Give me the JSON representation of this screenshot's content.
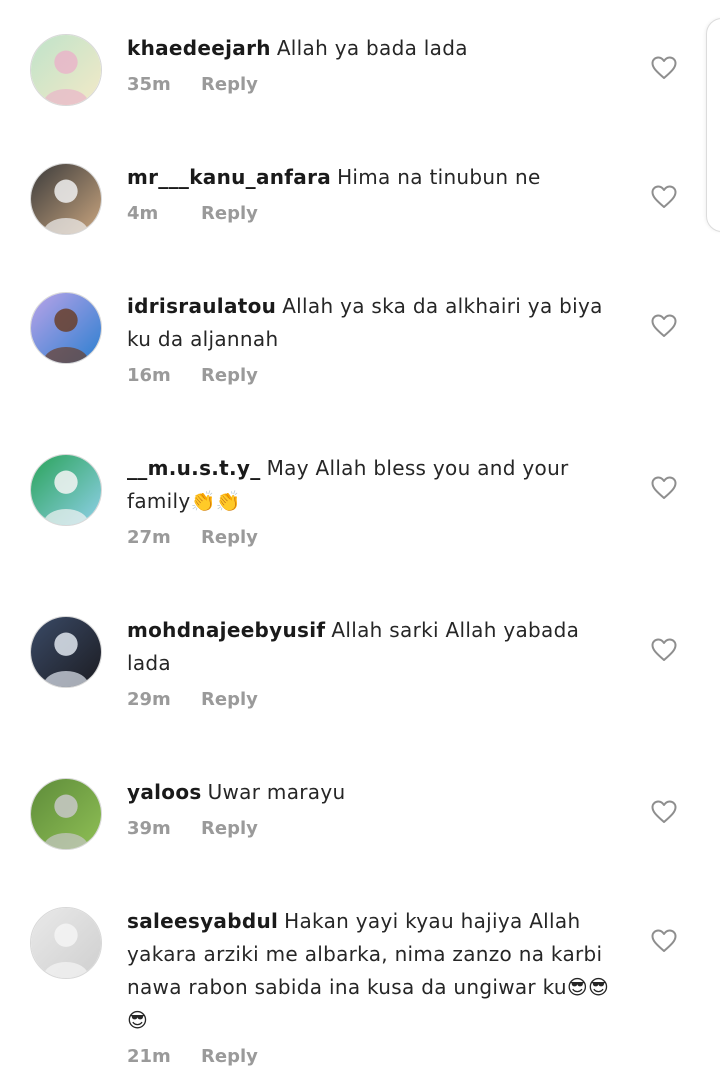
{
  "comments": [
    {
      "username": "khaedeejarh",
      "text": "Allah ya bada lada",
      "time": "35m",
      "reply": "Reply",
      "avatar": {
        "bg1": "#bfe3c9",
        "bg2": "#f3e9c8",
        "accent": "#e9b5c9"
      }
    },
    {
      "username": "mr___kanu_anfara",
      "text": "Hima na tinubun ne",
      "time": "4m",
      "reply": "Reply",
      "avatar": {
        "bg1": "#3b3b3b",
        "bg2": "#c9a57f",
        "accent": "#f0f0f0"
      }
    },
    {
      "username": "idrisraulatou",
      "text": "Allah ya ska da alkhairi ya biya ku da aljannah",
      "time": "16m",
      "reply": "Reply",
      "avatar": {
        "bg1": "#b9a3e8",
        "bg2": "#2b7fd0",
        "accent": "#6a3f2a"
      }
    },
    {
      "username": "__m.u.s.t.y_",
      "text": "May Allah bless you and your family👏👏",
      "time": "27m",
      "reply": "Reply",
      "avatar": {
        "bg1": "#2aa35a",
        "bg2": "#8fd0e8",
        "accent": "#f4f4f4"
      }
    },
    {
      "username": "mohdnajeebyusif",
      "text": "Allah sarki Allah yabada lada",
      "time": "29m",
      "reply": "Reply",
      "avatar": {
        "bg1": "#3a4a66",
        "bg2": "#1c1c22",
        "accent": "#dfe6ef"
      }
    },
    {
      "username": "yaloos",
      "text": "Uwar marayu",
      "time": "39m",
      "reply": "Reply",
      "avatar": {
        "bg1": "#5e8c3a",
        "bg2": "#8fbf55",
        "accent": "#c8c8c8"
      }
    },
    {
      "username": "saleesyabdul",
      "text": "Hakan yayi kyau hajiya Allah yakara arziki me albarka,  nima zanzo na karbi nawa rabon sabida ina kusa da ungiwar ku😎😎😎",
      "time": "21m",
      "reply": "Reply",
      "avatar": {
        "bg1": "#e9e9e9",
        "bg2": "#cfcfcf",
        "accent": "#f5f5f5"
      }
    }
  ],
  "colors": {
    "username": "#1a1a1a",
    "text": "#262626",
    "meta": "#9a9a9a",
    "heart": "#8e8e8e"
  },
  "icons": {
    "like": "heart-outline-icon"
  }
}
